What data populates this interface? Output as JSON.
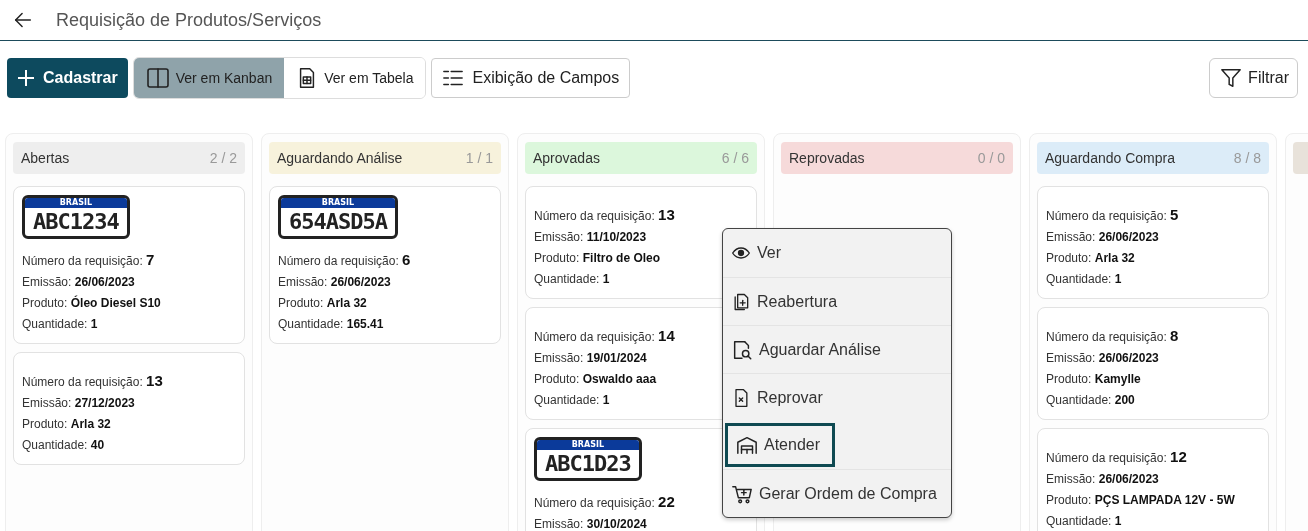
{
  "header": {
    "title": "Requisição de Produtos/Serviços"
  },
  "toolbar": {
    "create_button": "Cadastrar",
    "view_toggle": [
      {
        "label": "Ver em Kanban",
        "selected": true
      },
      {
        "label": "Ver em Tabela",
        "selected": false
      }
    ],
    "fields_button": "Exibição de Campos",
    "filter_button": "Filtrar"
  },
  "columns": [
    {
      "title": "Abertas",
      "count": "2 / 2",
      "color": "#eeeeee",
      "cards": [
        {
          "plate": "ABC1234",
          "plate_band": "BRASIL",
          "fields": [
            {
              "label": "Número da requisição:",
              "value": "7"
            },
            {
              "label": "Emissão:",
              "value": "26/06/2023"
            },
            {
              "label": "Produto:",
              "value": "Óleo Diesel S10"
            },
            {
              "label": "Quantidade:",
              "value": "1"
            }
          ]
        },
        {
          "fields": [
            {
              "label": "Número da requisição:",
              "value": "13"
            },
            {
              "label": "Emissão:",
              "value": "27/12/2023"
            },
            {
              "label": "Produto:",
              "value": "Arla 32"
            },
            {
              "label": "Quantidade:",
              "value": "40"
            }
          ]
        }
      ]
    },
    {
      "title": "Aguardando Análise",
      "count": "1 / 1",
      "color": "#f7f2dc",
      "cards": [
        {
          "plate": "654ASD5A",
          "plate_band": "BRASIL",
          "fields": [
            {
              "label": "Número da requisição:",
              "value": "6"
            },
            {
              "label": "Emissão:",
              "value": "26/06/2023"
            },
            {
              "label": "Produto:",
              "value": "Arla 32"
            },
            {
              "label": "Quantidade:",
              "value": "165.41"
            }
          ]
        }
      ]
    },
    {
      "title": "Aprovadas",
      "count": "6 / 6",
      "color": "#dcf7dc",
      "cards": [
        {
          "fields": [
            {
              "label": "Número da requisição:",
              "value": "13"
            },
            {
              "label": "Emissão:",
              "value": "11/10/2023"
            },
            {
              "label": "Produto:",
              "value": "Filtro de Oleo"
            },
            {
              "label": "Quantidade:",
              "value": "1"
            }
          ]
        },
        {
          "fields": [
            {
              "label": "Número da requisição:",
              "value": "14"
            },
            {
              "label": "Emissão:",
              "value": "19/01/2024"
            },
            {
              "label": "Produto:",
              "value": "Oswaldo aaa"
            },
            {
              "label": "Quantidade:",
              "value": "1"
            }
          ]
        },
        {
          "plate": "ABC1D23",
          "plate_band": "BRASIL",
          "fields": [
            {
              "label": "Número da requisição:",
              "value": "22"
            },
            {
              "label": "Emissão:",
              "value": "30/10/2024"
            }
          ]
        }
      ]
    },
    {
      "title": "Reprovadas",
      "count": "0 / 0",
      "color": "#f6dada"
    },
    {
      "title": "Aguardando Compra",
      "count": "8 / 8",
      "color": "#dcecf8",
      "cards": [
        {
          "fields": [
            {
              "label": "Número da requisição:",
              "value": "5"
            },
            {
              "label": "Emissão:",
              "value": "26/06/2023"
            },
            {
              "label": "Produto:",
              "value": "Arla 32"
            },
            {
              "label": "Quantidade:",
              "value": "1"
            }
          ]
        },
        {
          "fields": [
            {
              "label": "Número da requisição:",
              "value": "8"
            },
            {
              "label": "Emissão:",
              "value": "26/06/2023"
            },
            {
              "label": "Produto:",
              "value": "Kamylle"
            },
            {
              "label": "Quantidade:",
              "value": "200"
            }
          ]
        },
        {
          "fields": [
            {
              "label": "Número da requisição:",
              "value": "12"
            },
            {
              "label": "Emissão:",
              "value": "26/06/2023"
            },
            {
              "label": "Produto:",
              "value": "PÇS LAMPADA 12V - 5W"
            },
            {
              "label": "Quantidade:",
              "value": "1"
            }
          ]
        }
      ]
    },
    {
      "color": "#e8e2da"
    }
  ],
  "context_menu": [
    {
      "label": "Ver",
      "selected": false
    },
    {
      "label": "Reabertura",
      "selected": false
    },
    {
      "label": "Aguardar Análise",
      "selected": false
    },
    {
      "label": "Reprovar",
      "selected": false
    },
    {
      "label": "Atender",
      "selected": true
    },
    {
      "label": "Gerar Ordem de Compra",
      "selected": false
    }
  ]
}
